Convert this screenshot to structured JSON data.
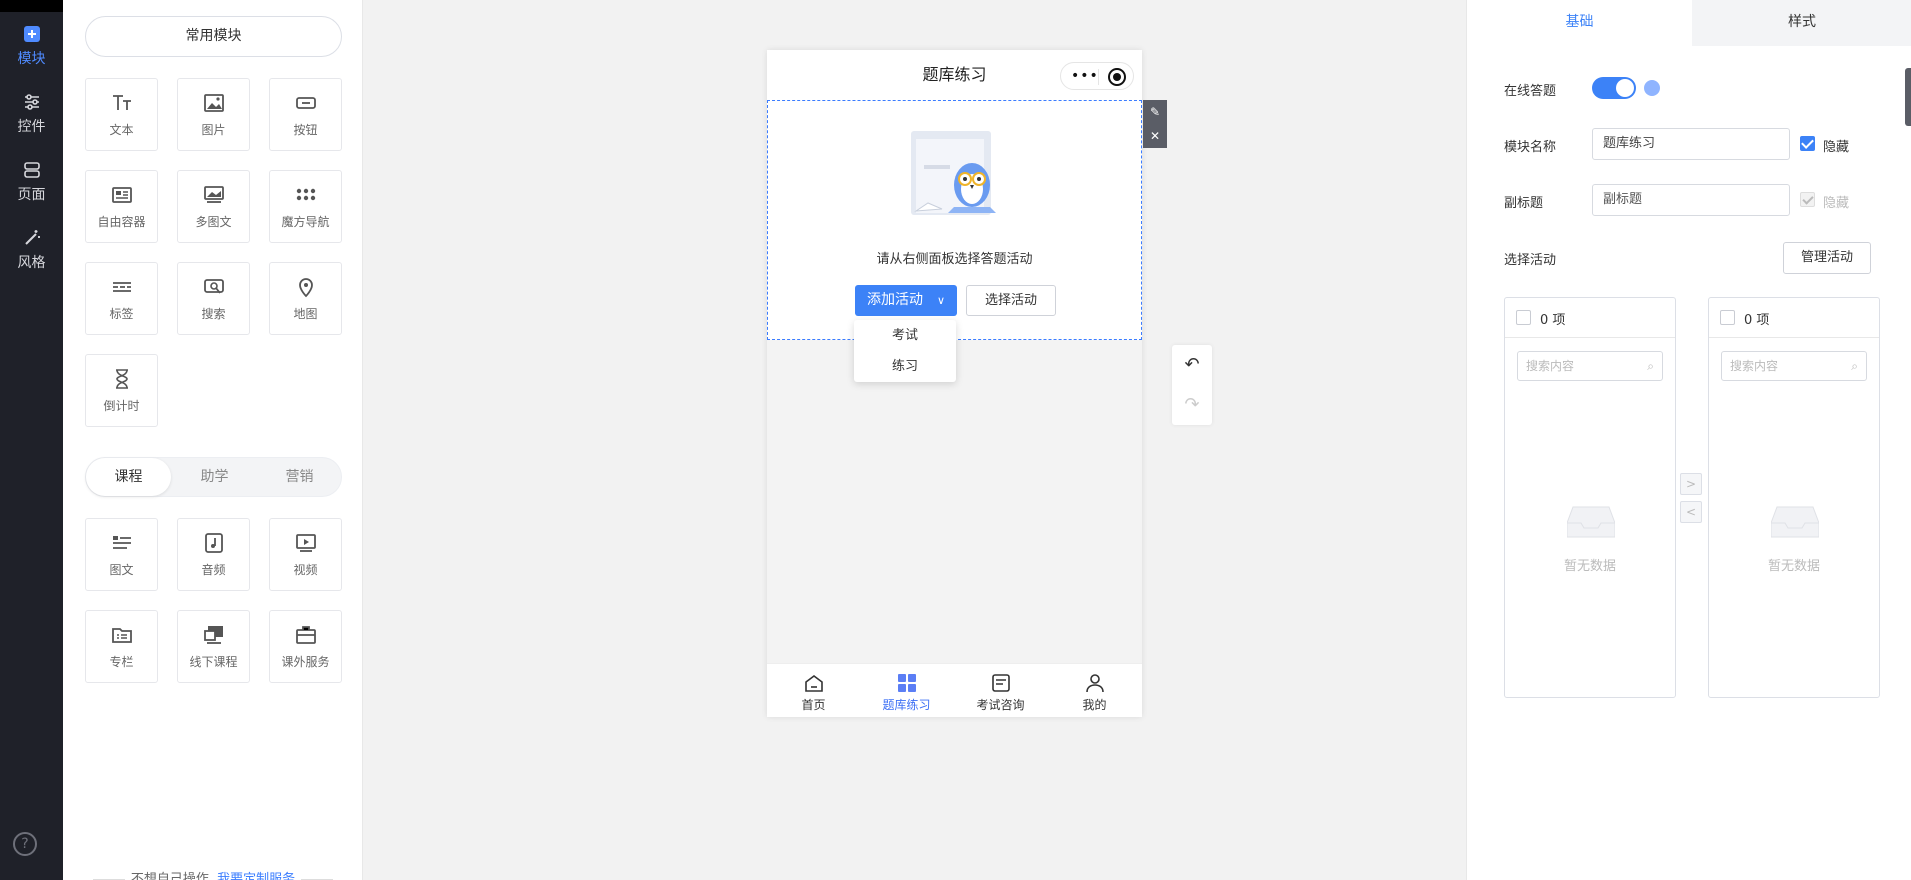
{
  "rail": {
    "items": [
      {
        "label": "模块",
        "icon": "plus-square-icon",
        "active": true
      },
      {
        "label": "控件",
        "icon": "sliders-icon",
        "active": false
      },
      {
        "label": "页面",
        "icon": "layers-icon",
        "active": false
      },
      {
        "label": "风格",
        "icon": "magic-wand-icon",
        "active": false
      }
    ],
    "help": "?"
  },
  "modules": {
    "common_label": "常用模块",
    "common_items": [
      "文本",
      "图片",
      "按钮",
      "自由容器",
      "多图文",
      "魔方导航",
      "标签",
      "搜索",
      "地图",
      "倒计时"
    ],
    "tabs": [
      "课程",
      "助学",
      "营销"
    ],
    "course_items": [
      "图文",
      "音频",
      "视频",
      "专栏",
      "线下课程",
      "课外服务"
    ],
    "footer_text": "不想自己操作",
    "footer_link": "我要定制服务"
  },
  "phone": {
    "title": "题库练习",
    "empty_text": "请从右侧面板选择答题活动",
    "add_button": "添加活动",
    "choose_button": "选择活动",
    "dropdown": [
      "考试",
      "练习"
    ],
    "tabbar": [
      {
        "label": "首页",
        "icon": "home-icon",
        "active": false
      },
      {
        "label": "题库练习",
        "icon": "grid-icon",
        "active": true
      },
      {
        "label": "考试咨询",
        "icon": "document-icon",
        "active": false
      },
      {
        "label": "我的",
        "icon": "user-icon",
        "active": false
      }
    ]
  },
  "settings": {
    "tabs": [
      "基础",
      "样式"
    ],
    "online_label": "在线答题",
    "online_enabled": true,
    "module_name_label": "模块名称",
    "module_name_value": "题库练习",
    "hide_label": "隐藏",
    "subtitle_label": "副标题",
    "subtitle_placeholder": "副标题",
    "hide_label_disabled": "隐藏",
    "select_activity_label": "选择活动",
    "manage_button": "管理活动",
    "transfer_left": {
      "count": "0 项",
      "search_placeholder": "搜索内容",
      "empty": "暂无数据"
    },
    "transfer_right": {
      "count": "0 项",
      "search_placeholder": "搜索内容",
      "empty": "暂无数据"
    },
    "arrow_right": ">",
    "arrow_left": "<"
  },
  "colors": {
    "accent": "#3c82f7",
    "rail_bg": "#1f2129"
  }
}
